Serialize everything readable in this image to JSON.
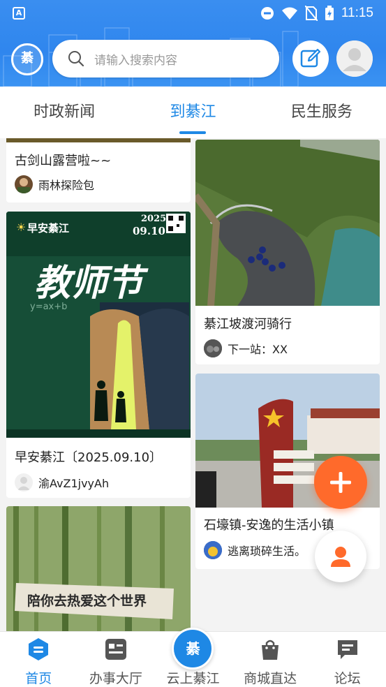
{
  "status_bar": {
    "time": "11:15",
    "app_badge": "A"
  },
  "header": {
    "logo_text": "綦",
    "search_placeholder": "请输入搜索内容"
  },
  "tabs": [
    {
      "label": "时政新闻",
      "active": false
    },
    {
      "label": "到綦江",
      "active": true
    },
    {
      "label": "民生服务",
      "active": false
    }
  ],
  "feed": {
    "left": [
      {
        "title": "古剑山露营啦~~",
        "author": "雨林探险包"
      },
      {
        "title": "早安綦江〔2025.09.10〕",
        "author": "渝AvZ1jvyAh",
        "poster": {
          "brand": "早安綦江",
          "year": "2025",
          "date": "09.10",
          "headline": "教师节",
          "formula": "y=ax+b"
        }
      },
      {
        "banner_text": "陪你去热爱这个世界"
      }
    ],
    "right": [
      {
        "title": "綦江坡渡河骑行",
        "author": "下一站：XX"
      },
      {
        "title": "石壕镇-安逸的生活小镇",
        "author": "逃离琐碎生活。"
      }
    ]
  },
  "fab": {
    "add_icon": "plus-icon",
    "user_icon": "user-icon"
  },
  "bottom_nav": [
    {
      "label": "首页",
      "icon": "home-icon",
      "active": true
    },
    {
      "label": "办事大厅",
      "icon": "hall-icon",
      "active": false
    },
    {
      "label": "云上綦江",
      "icon": "logo-icon",
      "active": false,
      "center_text": "綦"
    },
    {
      "label": "商城直达",
      "icon": "shop-icon",
      "active": false
    },
    {
      "label": "论坛",
      "icon": "forum-icon",
      "active": false
    }
  ],
  "colors": {
    "primary": "#1e88e5",
    "fab": "#ff6a2b",
    "header": "#2f86ee"
  }
}
